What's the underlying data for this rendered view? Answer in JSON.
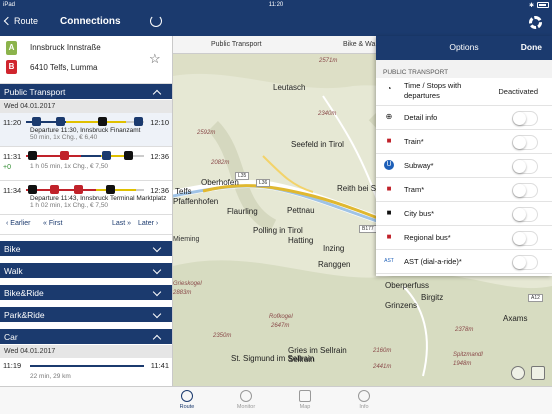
{
  "status_bar": {
    "carrier": "iPad",
    "time": "11:20"
  },
  "nav": {
    "back_label": "Route",
    "title": "Connections"
  },
  "route": {
    "from": "Innsbruck Innstraße",
    "to": "6410 Telfs, Lumma",
    "from_pin": "A",
    "to_pin": "B"
  },
  "public_transport": {
    "label": "Public Transport",
    "date": "Wed 04.01.2017",
    "connections": [
      {
        "dep": "11:20",
        "arr": "12:10",
        "delay": "",
        "line1": "Departure 11:30, Innsbruck Finanzamt",
        "line2": "50 min, 1x Chg., € 6,40"
      },
      {
        "dep": "11:31",
        "arr": "12:36",
        "delay": "+0",
        "line1": "",
        "line2": "1 h 05 min, 1x Chg., € 7,50"
      },
      {
        "dep": "11:34",
        "arr": "12:36",
        "delay": "",
        "line1": "Departure 11:43, Innsbruck Terminal Marktplatz",
        "line2": "1 h 02 min, 1x Chg., € 7,50"
      }
    ],
    "pager": {
      "earlier": "Earlier",
      "first": "First",
      "last": "Last",
      "later": "Later"
    }
  },
  "modes": [
    "Bike",
    "Walk",
    "Bike&Ride",
    "Park&Ride"
  ],
  "car": {
    "label": "Car",
    "date": "Wed 04.01.2017",
    "dep": "11:19",
    "arr": "11:41",
    "sub": "22 min, 29 km"
  },
  "map": {
    "tabs": [
      "Public Transport",
      "Bike & Wa"
    ],
    "places": [
      "Leutasch",
      "Seefeld in Tirol",
      "Oberhofen",
      "Telfs",
      "Inzing",
      "Pfaffenhofen",
      "Flaurling",
      "Pettnau",
      "Polling in Tirol",
      "Hatting",
      "Reith bei Seefeld",
      "Ranggen",
      "Oberperfuss",
      "Grinzens",
      "Birgitz",
      "Axams",
      "St. Sigmund im Sellrain",
      "Gries im Sellrain",
      "Sellrain",
      "Mieming"
    ],
    "peaks": [
      "2571m",
      "2340m",
      "2592m",
      "2082m",
      "Grieskogel",
      "2883m",
      "Rofkogel",
      "2647m",
      "2350m",
      "2378m",
      "2160m",
      "2441m",
      "Spitzmandl",
      "1948m"
    ],
    "roads": [
      "L35",
      "L36",
      "B177",
      "A12"
    ]
  },
  "options": {
    "title": "Options",
    "done": "Done",
    "section": "PUBLIC TRANSPORT",
    "rows": [
      {
        "label": "Time / Stops with departures",
        "value": "Deactivated"
      },
      {
        "label": "Detail info"
      },
      {
        "label": "Train*"
      },
      {
        "label": "Subway*"
      },
      {
        "label": "Tram*"
      },
      {
        "label": "City bus*"
      },
      {
        "label": "Regional bus*"
      },
      {
        "label": "AST (dial-a-ride)*"
      }
    ]
  },
  "tabbar": [
    "Route",
    "Monitor",
    "Map",
    "Info"
  ]
}
